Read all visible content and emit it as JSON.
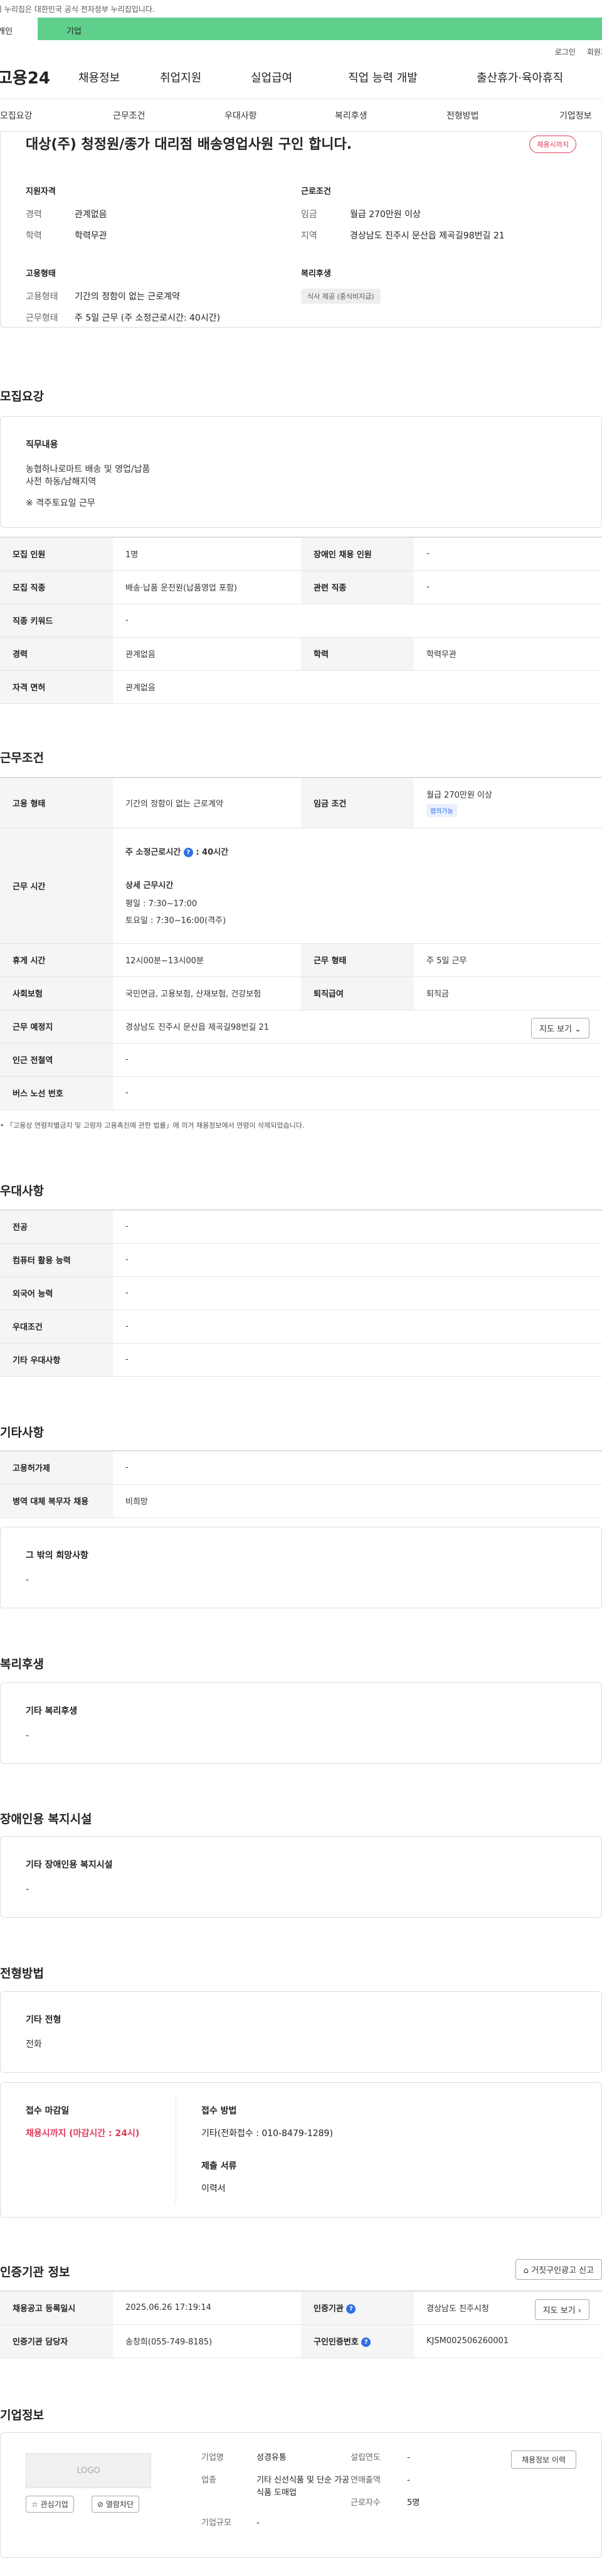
{
  "gov_banner": "이 누리집은 대한민국 공식 전자정부 누리집입니다.",
  "category": {
    "left": "개인",
    "active": "기업"
  },
  "util": {
    "login": "로그인",
    "signup": "회원가입"
  },
  "logo": "고용24",
  "gnb": [
    "채용정보",
    "취업지원",
    "실업급여",
    "직업 능력 개발",
    "출산휴가·육아휴직"
  ],
  "subtabs": [
    "모집요강",
    "근무조건",
    "우대사항",
    "복리후생",
    "전형방법",
    "기업정보"
  ],
  "summary": {
    "title": "대상(주) 청정원/종가 대리점 배송영업사원 구인 합니다.",
    "badge": "채용시까지",
    "qual_title": "지원자격",
    "career_k": "경력",
    "career_v": "관계없음",
    "edu_k": "학력",
    "edu_v": "학력무관",
    "emp_title": "고용형태",
    "emptype_k": "고용형태",
    "emptype_v": "기간의 정함이 없는 근로계약",
    "worktype_k": "근무형태",
    "worktype_v": "주 5일 근무 (주 소정근로시간: 40시간)",
    "cond_title": "근로조건",
    "wage_k": "임금",
    "wage_v": "월급 270만원 이상",
    "region_k": "지역",
    "region_v": "경상남도 진주시 문산읍 제곡길98번길 21",
    "welfare_title": "복리후생",
    "welfare_chip": "식사 제공 (중식비지급)"
  },
  "recruit": {
    "section_title": "모집요강",
    "job_title": "직무내용",
    "job_lines": [
      "농협하나로마트 배송 및 영업/납품",
      "사전 하동/남해지역",
      "※ 격주토요일 근무"
    ],
    "rows": {
      "headcount_k": "모집 인원",
      "headcount_v": "1명",
      "disabled_k": "장애인 채용 인원",
      "disabled_v": "-",
      "job_k": "모집 직종",
      "job_v": "배송·납품 운전원(납품영업 포함)",
      "related_k": "관련 직종",
      "related_v": "-",
      "keyword_k": "직종 키워드",
      "keyword_v": "-",
      "career_k": "경력",
      "career_v": "관계없음",
      "edu_k": "학력",
      "edu_v": "학력무관",
      "license_k": "자격 면허",
      "license_v": "관계없음"
    }
  },
  "work": {
    "section_title": "근무조건",
    "emptype_k": "고용 형태",
    "emptype_v": "기간의 정함이 없는 근로계약",
    "wage_k": "임금 조건",
    "wage_v": "월급 270만원 이상",
    "wage_chip": "협의가능",
    "hours_k": "근무 시간",
    "hours_main": "주 소정근로시간",
    "hours_main_val": ": 40시간",
    "detail_title": "상세 근무시간",
    "detail_lines": [
      "평일 : 7:30~17:00",
      "토요일 : 7:30~16:00(격주)"
    ],
    "break_k": "휴게 시간",
    "break_v": "12시00분~13시00분",
    "form_k": "근무 형태",
    "form_v": "주 5일 근무",
    "insurance_k": "사회보험",
    "insurance_v": "국민연금, 고용보험, 산재보험, 건강보험",
    "severance_k": "퇴직급여",
    "severance_v": "퇴직금",
    "place_k": "근무 예정지",
    "place_v": "경상남도 진주시 문산읍 제곡길98번길 21",
    "map_btn": "지도 보기",
    "subway_k": "인근 전철역",
    "subway_v": "-",
    "bus_k": "버스 노선 번호",
    "bus_v": "-",
    "notice": "「고용상 연령차별금지 및 고령자 고용촉진에 관한 법률」에 의거 채용정보에서 연령이 삭제되었습니다."
  },
  "pref": {
    "section_title": "우대사항",
    "rows": [
      {
        "k": "전공",
        "v": "-"
      },
      {
        "k": "컴퓨터 활용 능력",
        "v": "-"
      },
      {
        "k": "외국어 능력",
        "v": "-"
      },
      {
        "k": "우대조건",
        "v": "-"
      },
      {
        "k": "기타 우대사항",
        "v": "-"
      }
    ]
  },
  "etc": {
    "section_title": "기타사항",
    "rows": [
      {
        "k": "고용허가제",
        "v": "-"
      },
      {
        "k": "병역 대체 복무자 채용",
        "v": "비희망"
      }
    ],
    "other_title": "그 밖의 희망사항",
    "other_v": "-"
  },
  "welfare": {
    "section_title": "복리후생",
    "box_title": "기타 복리후생",
    "box_v": "-"
  },
  "facility": {
    "section_title": "장애인용 복지시설",
    "box_title": "기타 장애인용 복지시설",
    "box_v": "-"
  },
  "selection": {
    "section_title": "전형방법",
    "box_title": "기타 전형",
    "box_v": "전화",
    "deadline_title": "접수 마감일",
    "deadline_v": "채용시까지 (마감시간 : 24시)",
    "method_title": "접수 방법",
    "method_v": "기타(전화접수 : 010-8479-1289)",
    "docs_title": "제출 서류",
    "docs_v": "이력서"
  },
  "cert": {
    "section_title": "인증기관 정보",
    "report_btn": "거짓구인광고 신고",
    "reg_k": "채용공고 등록일시",
    "reg_v": "2025.06.26 17:19:14",
    "org_k": "인증기관",
    "org_v": "경상남도 진주시청",
    "map_btn": "지도 보기",
    "manager_k": "인증기관 담당자",
    "manager_v": "송창희(055-749-8185)",
    "certno_k": "구인인증번호",
    "certno_v": "KJSM002506260001"
  },
  "company": {
    "section_title": "기업정보",
    "logo_placeholder": "LOGO",
    "fav_btn": "관심기업",
    "block_btn": "열람차단",
    "name_k": "기업명",
    "name_v": "성경유통",
    "year_k": "설립연도",
    "year_v": "-",
    "industry_k": "업종",
    "industry_v": "기타 신선식품 및 단순 가공식품 도매업",
    "sales_k": "연매출액",
    "sales_v": "-",
    "staff_k": "근로자수",
    "staff_v": "5명",
    "size_k": "기업규모",
    "size_v": "-",
    "jobs_btn": "채용정보 이력"
  }
}
